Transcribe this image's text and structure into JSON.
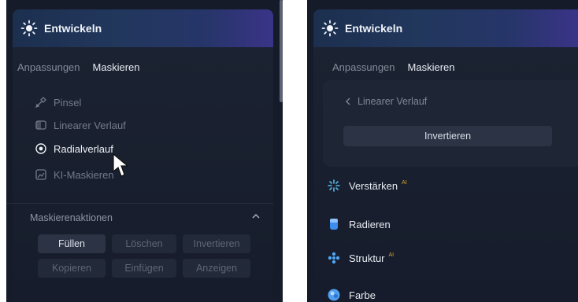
{
  "left_panel": {
    "header": {
      "title": "Entwickeln"
    },
    "tabs": [
      {
        "label": "Anpassungen",
        "active": false
      },
      {
        "label": "Maskieren",
        "active": true
      }
    ],
    "tools": [
      {
        "label": "Pinsel",
        "icon": "brush-icon",
        "selected": false
      },
      {
        "label": "Linearer Verlauf",
        "icon": "linear-gradient-icon",
        "selected": false
      },
      {
        "label": "Radialverlauf",
        "icon": "radial-gradient-icon",
        "selected": true
      },
      {
        "label": "KI-Maskieren",
        "icon": "ai-mask-icon",
        "selected": false
      }
    ],
    "mask_actions": {
      "title": "Maskierenaktionen",
      "buttons": [
        {
          "label": "Füllen",
          "enabled": true
        },
        {
          "label": "Löschen",
          "enabled": false
        },
        {
          "label": "Invertieren",
          "enabled": false
        },
        {
          "label": "Kopieren",
          "enabled": false
        },
        {
          "label": "Einfügen",
          "enabled": false
        },
        {
          "label": "Anzeigen",
          "enabled": false
        }
      ]
    }
  },
  "right_panel": {
    "header": {
      "title": "Entwickeln"
    },
    "tabs": [
      {
        "label": "Anpassungen",
        "active": false
      },
      {
        "label": "Maskieren",
        "active": true
      }
    ],
    "active_tool": {
      "back_label": "Linearer Verlauf",
      "invert_label": "Invertieren"
    },
    "tools": [
      {
        "label": "Verstärken",
        "badge": "AI",
        "icon": "sparkle-icon"
      },
      {
        "label": "Radieren",
        "badge": "",
        "icon": "eraser-icon"
      },
      {
        "label": "Struktur",
        "badge": "AI",
        "icon": "structure-icon"
      },
      {
        "label": "Farbe",
        "badge": "",
        "icon": "color-icon"
      }
    ]
  },
  "colors": {
    "panel_bg": "#151b29",
    "header_gradient_start": "#1c2f4f",
    "header_gradient_end": "#3a3488",
    "ai_badge": "#d4a630"
  }
}
